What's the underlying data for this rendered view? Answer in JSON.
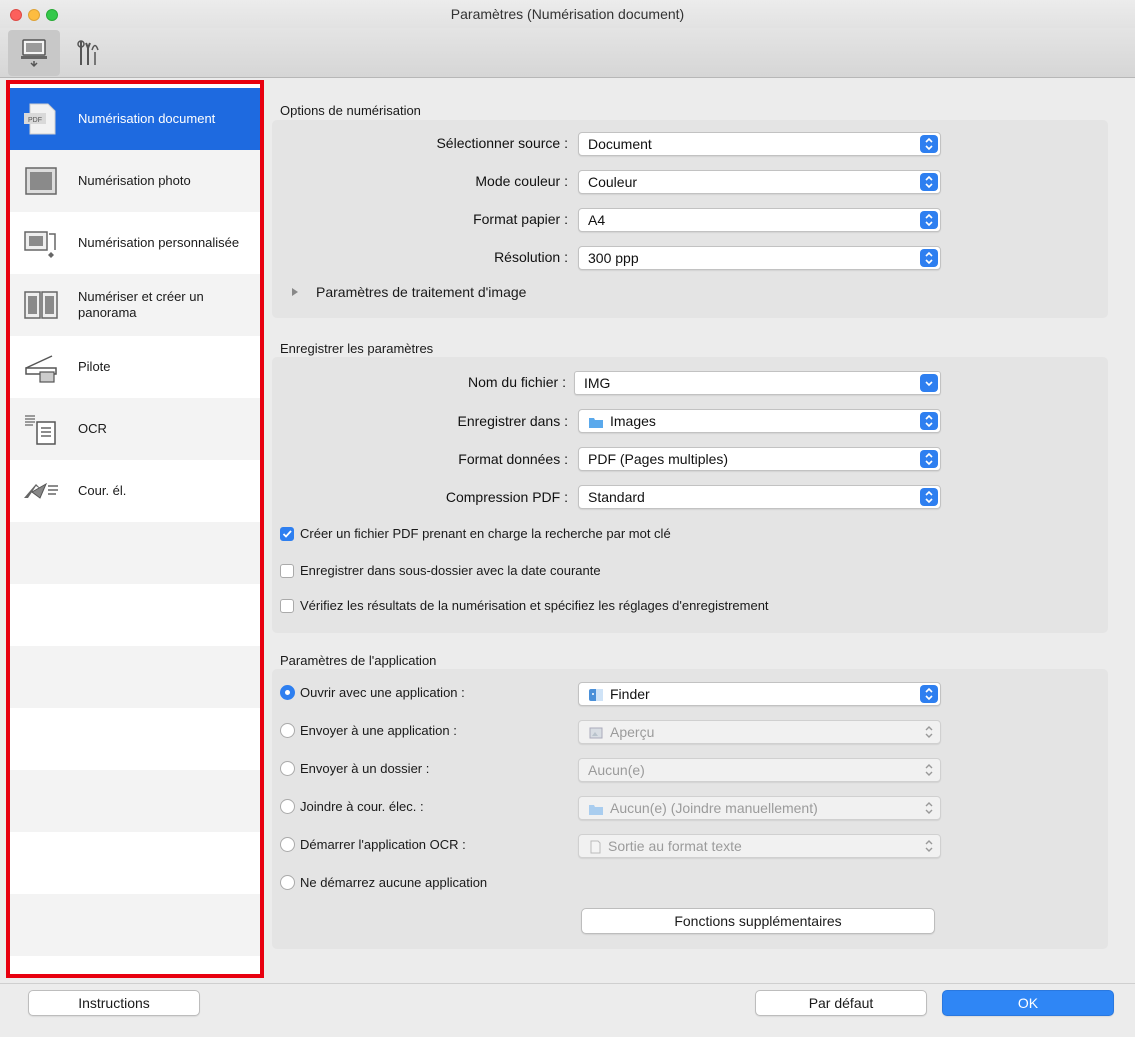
{
  "window": {
    "title": "Paramètres (Numérisation document)"
  },
  "sidebar": {
    "items": [
      {
        "label": "Numérisation document"
      },
      {
        "label": "Numérisation photo"
      },
      {
        "label": "Numérisation personnalisée"
      },
      {
        "label": "Numériser et créer un panorama"
      },
      {
        "label": "Pilote"
      },
      {
        "label": "OCR"
      },
      {
        "label": "Cour. él."
      }
    ]
  },
  "scan_options": {
    "title": "Options de numérisation",
    "source_label": "Sélectionner source :",
    "source_value": "Document",
    "color_label": "Mode couleur :",
    "color_value": "Couleur",
    "paper_label": "Format papier :",
    "paper_value": "A4",
    "resolution_label": "Résolution :",
    "resolution_value": "300 ppp",
    "image_processing_label": "Paramètres de traitement d'image"
  },
  "save_settings": {
    "title": "Enregistrer les paramètres",
    "filename_label": "Nom du fichier :",
    "filename_value": "IMG",
    "save_in_label": "Enregistrer dans :",
    "save_in_value": "Images",
    "data_format_label": "Format données :",
    "data_format_value": "PDF (Pages multiples)",
    "pdf_compression_label": "Compression PDF :",
    "pdf_compression_value": "Standard",
    "checkbox_keyword": "Créer un fichier PDF prenant en charge la recherche par mot clé",
    "checkbox_subfolder": "Enregistrer dans sous-dossier avec la date courante",
    "checkbox_verify": "Vérifiez les résultats de la numérisation et spécifiez les réglages d'enregistrement"
  },
  "app_settings": {
    "title": "Paramètres de l'application",
    "options": [
      {
        "label": "Ouvrir avec une application :",
        "value": "Finder"
      },
      {
        "label": "Envoyer à une application :",
        "value": "Aperçu"
      },
      {
        "label": "Envoyer à un dossier :",
        "value": "Aucun(e)"
      },
      {
        "label": "Joindre à cour. élec. :",
        "value": "Aucun(e) (Joindre manuellement)"
      },
      {
        "label": "Démarrer l'application OCR :",
        "value": "Sortie au format texte"
      },
      {
        "label": "Ne démarrez aucune application"
      }
    ],
    "more_functions": "Fonctions supplémentaires"
  },
  "footer": {
    "instructions": "Instructions",
    "defaults": "Par défaut",
    "ok": "OK"
  },
  "colors": {
    "accent": "#2e7ff0",
    "selection": "#1e6ae0",
    "highlight_border": "#e8000f"
  }
}
